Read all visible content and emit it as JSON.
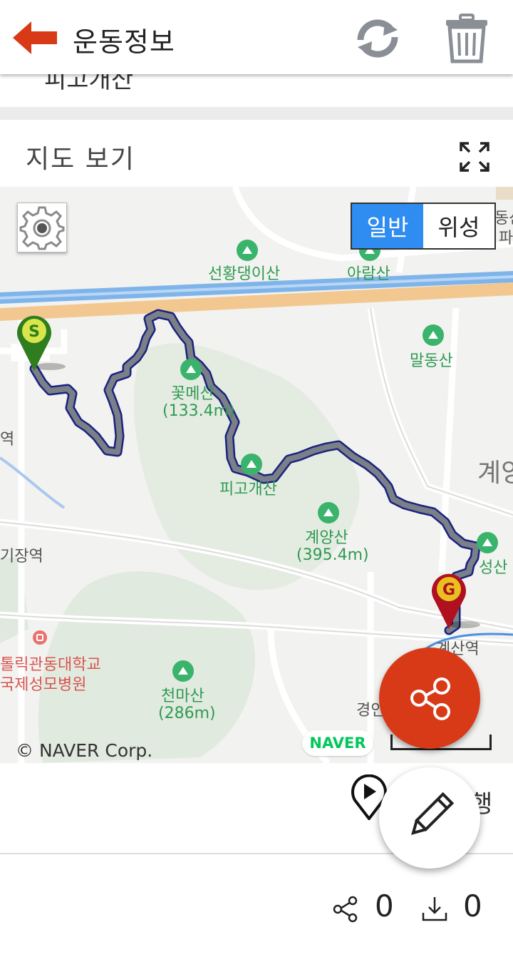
{
  "header": {
    "title": "운동정보",
    "back_icon": "arrow-left-icon",
    "refresh_icon": "refresh-icon",
    "delete_icon": "trash-icon",
    "accent_color": "#d83a18"
  },
  "scrolled_text": "피고개산",
  "map_section": {
    "title": "지도 보기",
    "fullscreen_icon": "expand-icon",
    "map_type": {
      "options": [
        "일반",
        "위성"
      ],
      "selected": "일반",
      "active_color": "#2f8cf0"
    },
    "settings_icon": "gear-icon",
    "start_marker": "S",
    "goal_marker": "G",
    "labels": {
      "seonhwang": "선황댕이산",
      "aram": "아람산",
      "maldong": "말동산",
      "kkotmae": "꽃메산",
      "kkotmae_elev": "(133.4m)",
      "pigogae": "피고개산",
      "gyeyang": "계양산",
      "gyeyang_elev": "(395.4m)",
      "seong": "성산",
      "gyesan_station": "계산역",
      "gyeong": "경인",
      "cheonma": "천마산",
      "cheonma_elev": "(286m)",
      "gyeyang_area": "계양",
      "hospital1": "톨릭관동대학교",
      "hospital2": "국제성모병원",
      "station_left": "역",
      "jangstation": "기장역",
      "top_right": "동산",
      "top_right2": "파"
    },
    "copyright": "© NAVER Corp.",
    "naver_logo": "NAVER",
    "route_color": "#7a7f88"
  },
  "fab": {
    "share_icon": "share-icon",
    "edit_icon": "pencil-icon"
  },
  "actions": {
    "play_icon": "play-pin-icon",
    "label": "행"
  },
  "footer": {
    "share_icon": "share-icon",
    "share_count": "0",
    "download_icon": "download-icon",
    "download_count": "0"
  }
}
